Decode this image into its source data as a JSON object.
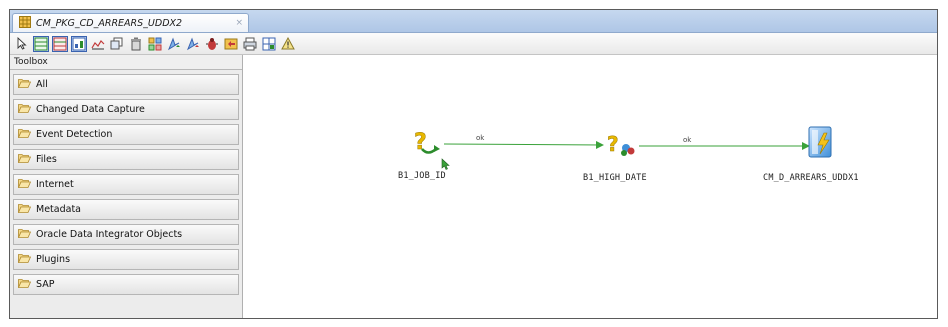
{
  "tab": {
    "title": "CM_PKG_CD_ARREARS_UDDX2",
    "close": "×"
  },
  "toolbar": {
    "buttons": [
      {
        "name": "select-tool-icon",
        "glyph": "⇱"
      },
      {
        "name": "ok-link-tool-icon",
        "glyph": "▤"
      },
      {
        "name": "ko-link-tool-icon",
        "glyph": "▤"
      },
      {
        "name": "diagram-view-icon",
        "glyph": "◩"
      },
      {
        "name": "chart-view-icon",
        "glyph": "⩍"
      },
      {
        "name": "duplicate-icon",
        "glyph": "❐"
      },
      {
        "name": "delete-icon",
        "glyph": "🗑"
      },
      {
        "name": "properties-icon",
        "glyph": "☰"
      },
      {
        "name": "next-step-ok-icon",
        "glyph": "➤"
      },
      {
        "name": "next-step-ko-icon",
        "glyph": "➤"
      },
      {
        "name": "debug-icon",
        "glyph": "✹"
      },
      {
        "name": "execute-icon",
        "glyph": "⚙"
      },
      {
        "name": "print-icon",
        "glyph": "⎙"
      },
      {
        "name": "layout-icon",
        "glyph": "⊞"
      },
      {
        "name": "warning-icon",
        "glyph": "⚠"
      }
    ]
  },
  "toolbox": {
    "title": "Toolbox",
    "items": [
      {
        "label": "All"
      },
      {
        "label": "Changed Data Capture"
      },
      {
        "label": "Event Detection"
      },
      {
        "label": "Files"
      },
      {
        "label": "Internet"
      },
      {
        "label": "Metadata"
      },
      {
        "label": "Oracle Data Integrator Objects"
      },
      {
        "label": "Plugins"
      },
      {
        "label": "SAP"
      }
    ]
  },
  "diagram": {
    "nodes": [
      {
        "id": "b1-job-id",
        "label": "B1_JOB_ID",
        "icon": "variable-refresh-icon"
      },
      {
        "id": "b1-high-date",
        "label": "B1_HIGH_DATE",
        "icon": "variable-evaluate-icon"
      },
      {
        "id": "cm-d-arrears",
        "label": "CM_D_ARREARS_UDDX1",
        "icon": "interface-icon"
      }
    ],
    "links": [
      {
        "from": "b1-job-id",
        "to": "b1-high-date",
        "label": "ok"
      },
      {
        "from": "b1-high-date",
        "to": "cm-d-arrears",
        "label": "ok"
      }
    ]
  },
  "colors": {
    "tab_bar": "#aec6e6",
    "link_ok": "#3aa23a",
    "variable_icon": "#e8b800",
    "interface_icon": "#3f8fd8"
  }
}
